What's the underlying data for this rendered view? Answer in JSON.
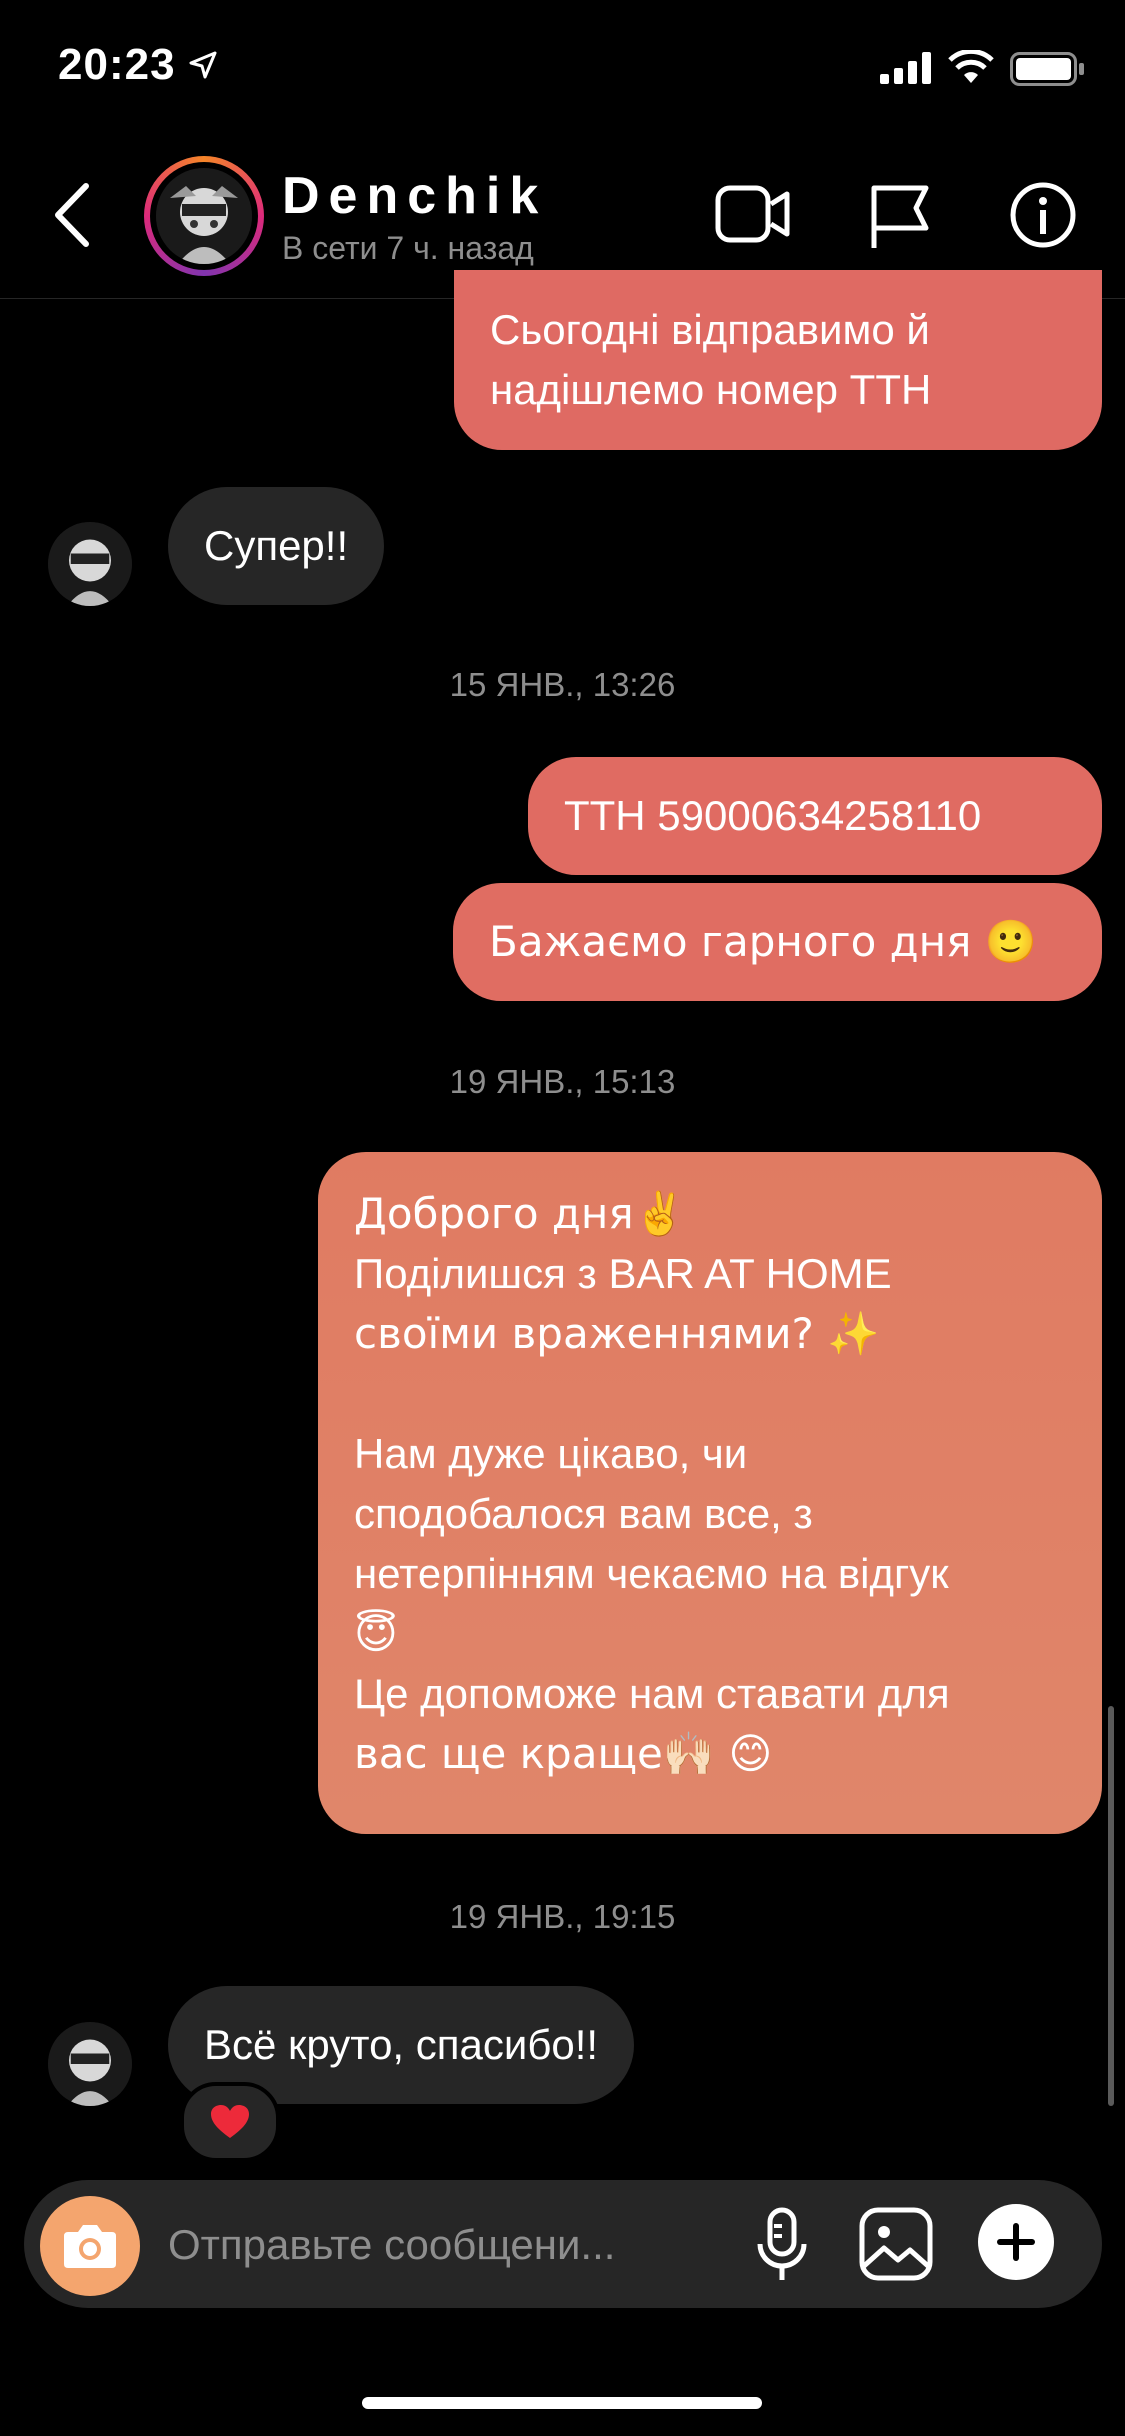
{
  "status_bar": {
    "time": "20:23"
  },
  "header": {
    "contact_name": "Denchik",
    "contact_status": "В сети 7 ч. назад"
  },
  "messages": {
    "m1_line1": "Сьогодні відправимо й",
    "m1_line2": "надішлемо номер ТТН",
    "m2": "Супер!!",
    "date1": "15 ЯНВ., 13:26",
    "m3": "ТТН 59000634258110",
    "m4": "Бажаємо гарного дня 🙂",
    "date2": "19 ЯНВ., 15:13",
    "m5_lines": [
      "Доброго дня✌️",
      "Поділишся з BAR AT HOME",
      "своїми враженнями? ✨",
      "",
      "Нам дуже цікаво, чи",
      "сподобалося вам все, з",
      "нетерпінням чекаємо на відгук",
      "😇",
      "Це допоможе нам ставати для",
      "вас ще краще🙌🏻 😊"
    ],
    "date3": "19 ЯНВ., 19:15",
    "m6": "Всё круто, спасибо!!",
    "m6_reaction": "❤️"
  },
  "composer": {
    "placeholder": "Отправьте сообщени..."
  },
  "colors": {
    "bubble_out_top": "#df6a63",
    "bubble_out_mid": "#e0755f",
    "bubble_out_bottom": "#e08566",
    "bubble_in": "#262626",
    "camera_button": "#f4a56e"
  },
  "icons": [
    "location-arrow-icon",
    "signal-icon",
    "wifi-icon",
    "battery-icon",
    "back-icon",
    "video-icon",
    "flag-icon",
    "info-icon",
    "camera-icon",
    "mic-icon",
    "gallery-icon",
    "plus-icon",
    "heart-icon"
  ]
}
